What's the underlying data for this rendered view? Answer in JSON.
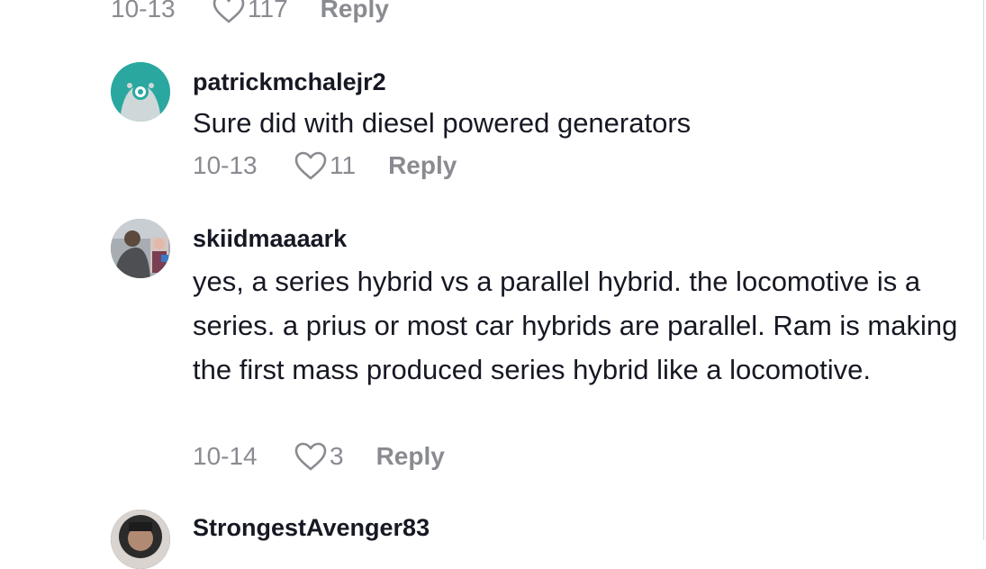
{
  "comments": [
    {
      "date": "10-13",
      "likes": "117",
      "reply_label": "Reply",
      "avatar_icon": "avatar-icon"
    },
    {
      "username": "patrickmchalejr2",
      "text": "Sure did with diesel powered generators",
      "date": "10-13",
      "likes": "11",
      "reply_label": "Reply",
      "avatar_icon": "default-avatar-icon"
    },
    {
      "username": "skiidmaaaark",
      "text": "yes, a series hybrid vs a parallel hybrid. the locomotive is a series. a prius or most car hybrids are parallel. Ram is making the first mass produced series hybrid like a locomotive.",
      "date": "10-14",
      "likes": "3",
      "reply_label": "Reply",
      "avatar_icon": "photo-avatar"
    },
    {
      "username": "StrongestAvenger83",
      "avatar_icon": "photo-avatar"
    }
  ],
  "colors": {
    "text": "#161823",
    "meta": "#8a8b91",
    "default_avatar_bg": "#2aa8a0"
  }
}
